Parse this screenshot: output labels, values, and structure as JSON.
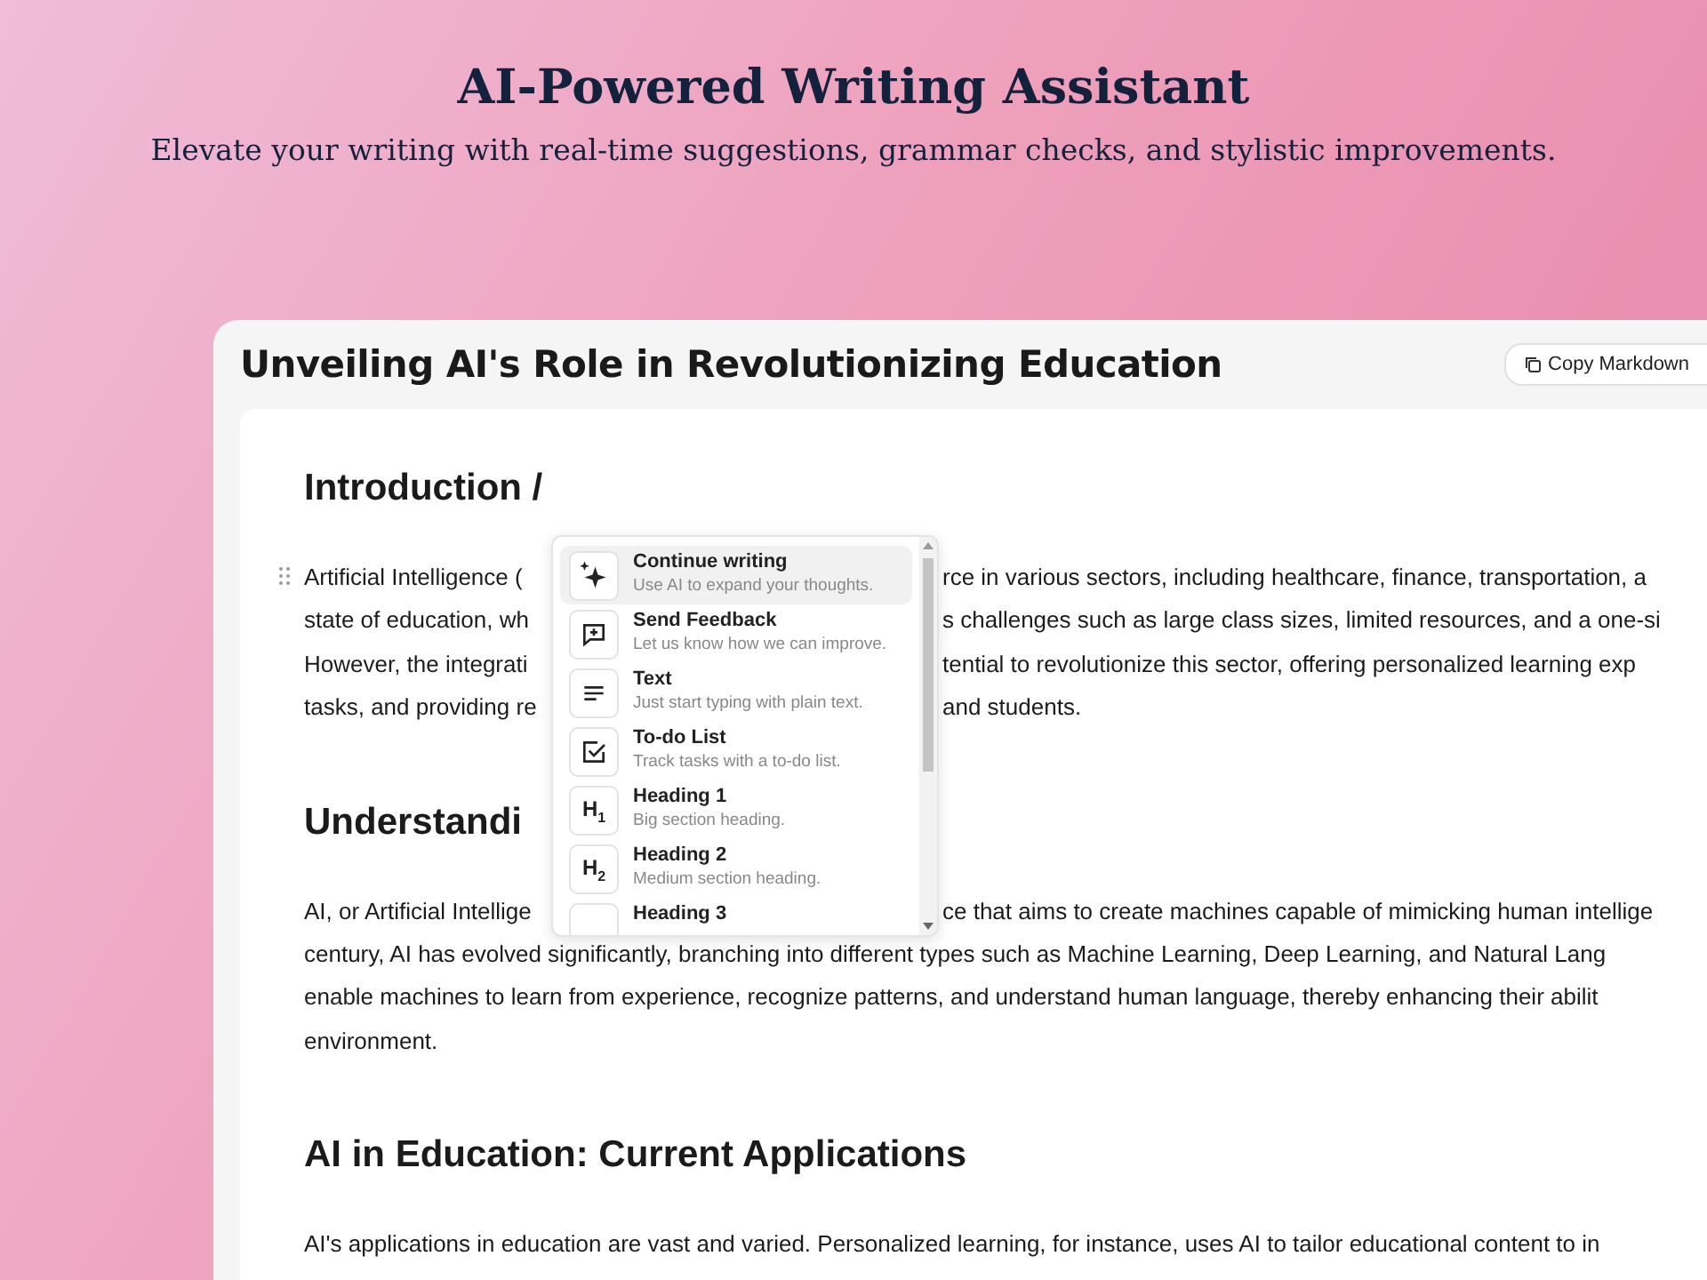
{
  "header": {
    "title": "AI-Powered Writing Assistant",
    "subtitle": "Elevate your writing with real-time suggestions, grammar checks, and stylistic improvements."
  },
  "document": {
    "title": "Unveiling AI's Role in Revolutionizing Education",
    "copy_button": "Copy Markdown",
    "blocks": [
      {
        "kind": "heading",
        "text": "Introduction /"
      },
      {
        "kind": "paragraph",
        "drag_handle": true,
        "lines": [
          {
            "left": "Artificial Intelligence (",
            "right": "rce in various sectors, including healthcare, finance, transportation, a"
          },
          {
            "left": "state of education, wh",
            "right": "s challenges such as large class sizes, limited resources, and a one-si"
          },
          {
            "left": "However, the integrati",
            "right": "tential to revolutionize this sector, offering personalized learning exp"
          },
          {
            "left": "tasks, and providing re",
            "right": "and students."
          }
        ]
      },
      {
        "kind": "heading",
        "text": "Understandi"
      },
      {
        "kind": "paragraph",
        "drag_handle": false,
        "lines": [
          {
            "left": "AI, or Artificial Intellige",
            "right": "ce that aims to create machines capable of mimicking human intellige"
          },
          {
            "left": "century, AI has evolved significantly, branching into different types such as Machine Learning, Deep Learning, and Natural Lang"
          },
          {
            "left": "enable machines to learn from experience, recognize patterns, and understand human language, thereby enhancing their abilit"
          },
          {
            "left": "environment."
          }
        ]
      },
      {
        "kind": "heading",
        "text": "AI in Education: Current Applications"
      },
      {
        "kind": "paragraph",
        "drag_handle": false,
        "lines": [
          {
            "left": "AI's applications in education are vast and varied. Personalized learning, for instance, uses AI to tailor educational content to in"
          }
        ]
      }
    ]
  },
  "slash_menu": {
    "items": [
      {
        "kind": "sparkle",
        "title": "Continue writing",
        "description": "Use AI to expand your thoughts.",
        "selected": true
      },
      {
        "kind": "feedback",
        "title": "Send Feedback",
        "description": "Let us know how we can improve.",
        "selected": false
      },
      {
        "kind": "text",
        "title": "Text",
        "description": "Just start typing with plain text.",
        "selected": false
      },
      {
        "kind": "todo",
        "title": "To-do List",
        "description": "Track tasks with a to-do list.",
        "selected": false
      },
      {
        "kind": "heading",
        "icon_text": "H$_{1}$",
        "title": "Heading 1",
        "description": "Big section heading.",
        "selected": false
      },
      {
        "kind": "heading",
        "icon_text": "H$_{2}$",
        "title": "Heading 2",
        "description": "Medium section heading.",
        "selected": false
      },
      {
        "kind": "heading",
        "title": "Heading 3",
        "selected": false
      }
    ]
  }
}
